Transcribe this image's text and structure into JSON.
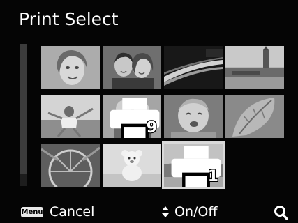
{
  "header": {
    "title": "Print Select"
  },
  "grid": {
    "thumbnails": [
      {
        "subject": "woman-portrait"
      },
      {
        "subject": "couple-portrait"
      },
      {
        "subject": "night-highway"
      },
      {
        "subject": "big-ben-cityscape"
      },
      {
        "subject": "children-playing"
      },
      {
        "subject": "twin-toddlers",
        "print_count": "9"
      },
      {
        "subject": "crying-child"
      },
      {
        "subject": "leaf-closeup"
      },
      {
        "subject": "ferris-wheel"
      },
      {
        "subject": "teddy-bear"
      },
      {
        "subject": "beach-landscape",
        "print_count": "1",
        "selected": true
      }
    ]
  },
  "footer": {
    "menu_key": "Menu",
    "cancel_label": "Cancel",
    "onoff_label": "On/Off"
  },
  "icons": [
    "printer-icon",
    "up-down-arrow-icon",
    "zoom-icon"
  ]
}
